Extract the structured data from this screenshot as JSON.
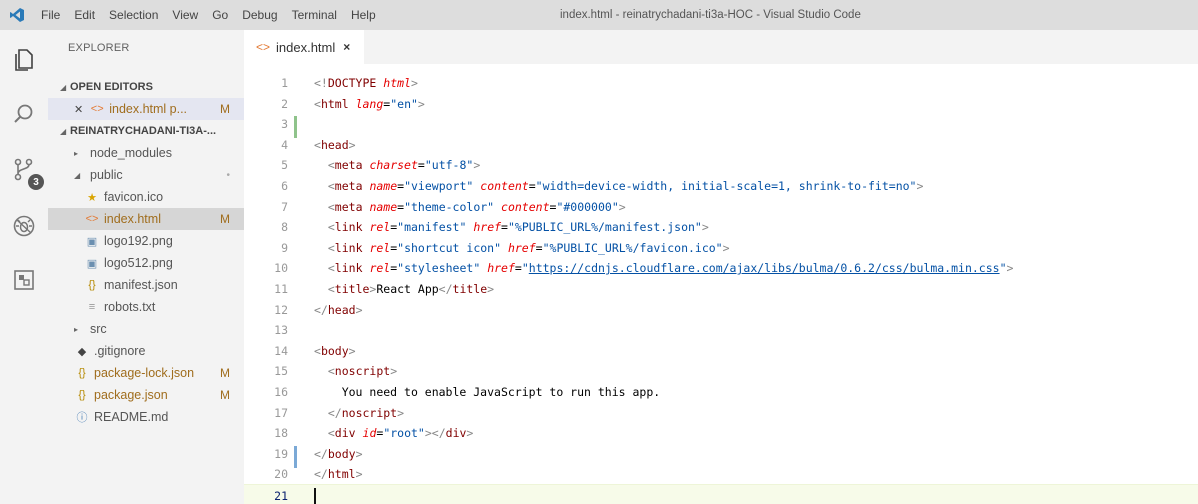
{
  "window": {
    "title": "index.html - reinatrychadani-ti3a-HOC - Visual Studio Code"
  },
  "menu": [
    "File",
    "Edit",
    "Selection",
    "View",
    "Go",
    "Debug",
    "Terminal",
    "Help"
  ],
  "activity": {
    "scm_badge": "3"
  },
  "sidebar": {
    "title": "EXPLORER",
    "open_editors_label": "OPEN EDITORS",
    "open_editor_item": "index.html p...",
    "open_editor_status": "M",
    "project_label": "REINATRYCHADANI-TI3A-...",
    "tree": [
      {
        "label": "node_modules",
        "type": "folder",
        "open": false,
        "level": 1
      },
      {
        "label": "public",
        "type": "folder",
        "open": true,
        "level": 1,
        "status": "•"
      },
      {
        "label": "favicon.ico",
        "type": "ico",
        "level": 2
      },
      {
        "label": "index.html",
        "type": "html",
        "level": 2,
        "status": "M",
        "active": true
      },
      {
        "label": "logo192.png",
        "type": "png",
        "level": 2
      },
      {
        "label": "logo512.png",
        "type": "png",
        "level": 2
      },
      {
        "label": "manifest.json",
        "type": "json",
        "level": 2
      },
      {
        "label": "robots.txt",
        "type": "txt",
        "level": 2
      },
      {
        "label": "src",
        "type": "folder",
        "open": false,
        "level": 1
      },
      {
        "label": ".gitignore",
        "type": "git",
        "level": 1
      },
      {
        "label": "package-lock.json",
        "type": "json",
        "level": 1,
        "status": "M"
      },
      {
        "label": "package.json",
        "type": "json",
        "level": 1,
        "status": "M"
      },
      {
        "label": "README.md",
        "type": "info",
        "level": 1
      }
    ]
  },
  "tab": {
    "label": "index.html",
    "close": "×"
  },
  "editor": {
    "current_line": 21,
    "lines": [
      {
        "n": "1",
        "html": "<span class=\"p\">&lt;!</span><span class=\"t\">DOCTYPE</span> <span class=\"a\">html</span><span class=\"p\">&gt;</span>"
      },
      {
        "n": "2",
        "html": "<span class=\"p\">&lt;</span><span class=\"t\">html</span> <span class=\"a\">lang</span><span class=\"tx\">=</span><span class=\"v\">\"en\"</span><span class=\"p\">&gt;</span>"
      },
      {
        "n": "3",
        "html": ""
      },
      {
        "n": "4",
        "html": "<span class=\"p\">&lt;</span><span class=\"t\">head</span><span class=\"p\">&gt;</span>"
      },
      {
        "n": "5",
        "html": "  <span class=\"p\">&lt;</span><span class=\"t\">meta</span> <span class=\"a\">charset</span><span class=\"tx\">=</span><span class=\"v\">\"utf-8\"</span><span class=\"p\">&gt;</span>"
      },
      {
        "n": "6",
        "html": "  <span class=\"p\">&lt;</span><span class=\"t\">meta</span> <span class=\"a\">name</span><span class=\"tx\">=</span><span class=\"v\">\"viewport\"</span> <span class=\"a\">content</span><span class=\"tx\">=</span><span class=\"v\">\"width=device-width, initial-scale=1, shrink-to-fit=no\"</span><span class=\"p\">&gt;</span>"
      },
      {
        "n": "7",
        "html": "  <span class=\"p\">&lt;</span><span class=\"t\">meta</span> <span class=\"a\">name</span><span class=\"tx\">=</span><span class=\"v\">\"theme-color\"</span> <span class=\"a\">content</span><span class=\"tx\">=</span><span class=\"v\">\"#000000\"</span><span class=\"p\">&gt;</span>"
      },
      {
        "n": "8",
        "html": "  <span class=\"p\">&lt;</span><span class=\"t\">link</span> <span class=\"a\">rel</span><span class=\"tx\">=</span><span class=\"v\">\"manifest\"</span> <span class=\"a\">href</span><span class=\"tx\">=</span><span class=\"v\">\"%PUBLIC_URL%/manifest.json\"</span><span class=\"p\">&gt;</span>"
      },
      {
        "n": "9",
        "html": "  <span class=\"p\">&lt;</span><span class=\"t\">link</span> <span class=\"a\">rel</span><span class=\"tx\">=</span><span class=\"v\">\"shortcut icon\"</span> <span class=\"a\">href</span><span class=\"tx\">=</span><span class=\"v\">\"%PUBLIC_URL%/favicon.ico\"</span><span class=\"p\">&gt;</span>"
      },
      {
        "n": "10",
        "html": "  <span class=\"p\">&lt;</span><span class=\"t\">link</span> <span class=\"a\">rel</span><span class=\"tx\">=</span><span class=\"v\">\"stylesheet\"</span> <span class=\"a\">href</span><span class=\"tx\">=</span><span class=\"v\">\"</span><span class=\"v u\">https://cdnjs.cloudflare.com/ajax/libs/bulma/0.6.2/css/bulma.min.css</span><span class=\"v\">\"</span><span class=\"p\">&gt;</span>"
      },
      {
        "n": "11",
        "html": "  <span class=\"p\">&lt;</span><span class=\"t\">title</span><span class=\"p\">&gt;</span><span class=\"tx\">React App</span><span class=\"p\">&lt;/</span><span class=\"t\">title</span><span class=\"p\">&gt;</span>"
      },
      {
        "n": "12",
        "html": "<span class=\"p\">&lt;/</span><span class=\"t\">head</span><span class=\"p\">&gt;</span>"
      },
      {
        "n": "13",
        "html": ""
      },
      {
        "n": "14",
        "html": "<span class=\"p\">&lt;</span><span class=\"t\">body</span><span class=\"p\">&gt;</span>"
      },
      {
        "n": "15",
        "html": "  <span class=\"p\">&lt;</span><span class=\"t\">noscript</span><span class=\"p\">&gt;</span>"
      },
      {
        "n": "16",
        "html": "    <span class=\"tx\">You need to enable JavaScript to run this app.</span>"
      },
      {
        "n": "17",
        "html": "  <span class=\"p\">&lt;/</span><span class=\"t\">noscript</span><span class=\"p\">&gt;</span>"
      },
      {
        "n": "18",
        "html": "  <span class=\"p\">&lt;</span><span class=\"t\">div</span> <span class=\"a\">id</span><span class=\"tx\">=</span><span class=\"v\">\"root\"</span><span class=\"p\">&gt;&lt;/</span><span class=\"t\">div</span><span class=\"p\">&gt;</span>"
      },
      {
        "n": "19",
        "html": "<span class=\"p\">&lt;/</span><span class=\"t\">body</span><span class=\"p\">&gt;</span>"
      },
      {
        "n": "20",
        "html": "<span class=\"p\">&lt;/</span><span class=\"t\">html</span><span class=\"p\">&gt;</span>"
      },
      {
        "n": "21",
        "html": ""
      }
    ]
  },
  "colors": {
    "html_icon": "#e37933",
    "modified": "#a06d1d",
    "tag": "#800000",
    "attribute": "#e50000",
    "string": "#0451a5"
  }
}
